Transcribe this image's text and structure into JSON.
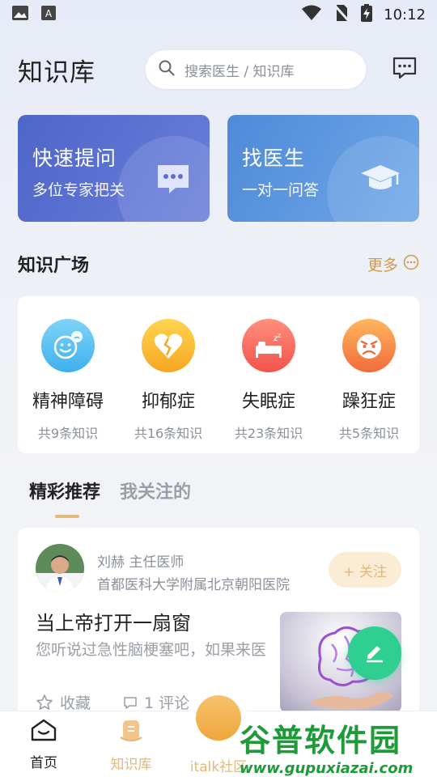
{
  "status_bar": {
    "time": "10:12"
  },
  "header": {
    "title": "知识库",
    "search_placeholder": "搜索医生 / 知识库"
  },
  "cards": [
    {
      "title": "快速提问",
      "subtitle": "多位专家把关"
    },
    {
      "title": "找医生",
      "subtitle": "一对一问答"
    }
  ],
  "knowledge_section": {
    "title": "知识广场",
    "more_label": "更多"
  },
  "topics": [
    {
      "name": "精神障碍",
      "count": "共9条知识"
    },
    {
      "name": "抑郁症",
      "count": "共16条知识"
    },
    {
      "name": "失眠症",
      "count": "共23条知识"
    },
    {
      "name": "躁狂症",
      "count": "共5条知识"
    }
  ],
  "feed_tabs": [
    {
      "label": "精彩推荐",
      "active": true
    },
    {
      "label": "我关注的",
      "active": false
    }
  ],
  "post": {
    "author": "刘赫 主任医师",
    "hospital": "首都医科大学附属北京朝阳医院",
    "follow_label": "+ 关注",
    "title": "当上帝打开一扇窗",
    "excerpt": "您听说过急性脑梗塞吧，如果来医",
    "collect_label": "收藏",
    "comment_label": "1 评论"
  },
  "bottom_nav": [
    {
      "label": "首页"
    },
    {
      "label": "知识库"
    },
    {
      "label": "italk社区"
    },
    {
      "label": ""
    },
    {
      "label": ""
    }
  ],
  "watermark": {
    "title": "谷普软件园",
    "url": "www.gupuxiazai.com"
  },
  "colors": {
    "accent_gold": "#e3b87a",
    "card_ask": "#4e66c8",
    "card_doctor": "#4f8ad8",
    "fab_green": "#2fcf91"
  }
}
